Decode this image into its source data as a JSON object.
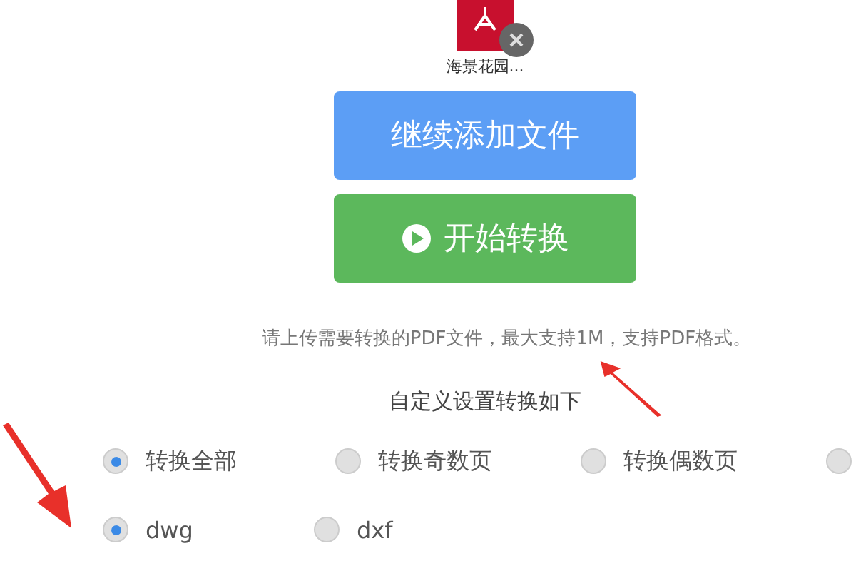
{
  "file": {
    "name": "海景花园..."
  },
  "buttons": [
    {
      "label": "继续添加文件",
      "kind": "add"
    },
    {
      "label": "开始转换",
      "kind": "start"
    }
  ],
  "hint": "请上传需要转换的PDF文件，最大支持1M，支持PDF格式。",
  "settings_title": "自定义设置转换如下",
  "page_options": [
    {
      "label": "转换全部",
      "selected": true
    },
    {
      "label": "转换奇数页",
      "selected": false
    },
    {
      "label": "转换偶数页",
      "selected": false
    },
    {
      "selected": false
    }
  ],
  "format_options": [
    {
      "label": "dwg",
      "selected": true
    },
    {
      "label": "dxf",
      "selected": false
    }
  ]
}
